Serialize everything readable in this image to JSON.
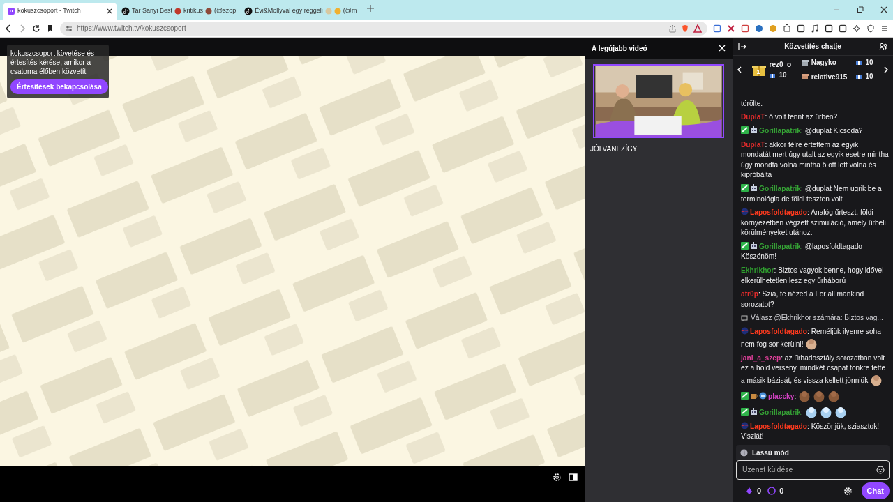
{
  "browser": {
    "tabs": [
      {
        "selected": true,
        "favicon": {
          "kind": "twitch"
        },
        "parts": [
          {
            "kind": "text",
            "text": "kokuszcsoport - Twitch"
          }
        ]
      },
      {
        "selected": false,
        "favicon": {
          "kind": "tiktok"
        },
        "parts": [
          {
            "kind": "text",
            "text": "Tar Sanyi Best"
          },
          {
            "kind": "emoji",
            "color": "#c0392b"
          },
          {
            "kind": "text",
            "text": "kritikus"
          },
          {
            "kind": "emoji",
            "color": "#8e4a3a"
          },
          {
            "kind": "text",
            "text": "(@szop"
          }
        ]
      },
      {
        "selected": false,
        "favicon": {
          "kind": "tiktok"
        },
        "parts": [
          {
            "kind": "text",
            "text": "Évi&Mollyval egy reggeli"
          },
          {
            "kind": "emoji",
            "color": "#d8c8a0"
          },
          {
            "kind": "emoji",
            "color": "#f0b030"
          },
          {
            "kind": "text",
            "text": "(@m"
          }
        ]
      }
    ],
    "url": "https://www.twitch.tv/kokuszcsoport"
  },
  "notice": {
    "text": "kokuszcsoport követése és értesítés kérése, amikor a csatorna élőben közvetít",
    "button": "Értesítések bekapcsolása"
  },
  "latest_video": {
    "heading": "A legújabb videó",
    "channel": "JÓLVANEZÍGY"
  },
  "chat": {
    "title": "Közvetítés chatje",
    "leaderboard": [
      {
        "rank": "1",
        "user": "rez0_o",
        "count": "10"
      },
      {
        "user": "Nagyko",
        "count": "10"
      },
      {
        "user": "relative915",
        "count": "10"
      }
    ],
    "messages": [
      {
        "kind": "system",
        "text": "törölte."
      },
      {
        "kind": "message",
        "user": "DuplaT",
        "color": "#e02b2b",
        "text": ": ő volt fennt az űrben?"
      },
      {
        "kind": "message",
        "badges": [
          {
            "kind": "check"
          },
          {
            "kind": "robot"
          }
        ],
        "user": "Gorillapatrik",
        "color": "#35a135",
        "text": ": @duplat Kicsoda?"
      },
      {
        "kind": "message",
        "user": "DuplaT",
        "color": "#e02b2b",
        "text": ": akkor félre értettem az egyik mondatát mert úgy utalt az egyik esetre mintha úgy mondta volna mintha ő ott lett volna és kipróbálta"
      },
      {
        "kind": "message",
        "badges": [
          {
            "kind": "check"
          },
          {
            "kind": "robot"
          }
        ],
        "user": "Gorillapatrik",
        "color": "#35a135",
        "text": ": @duplat Nem ugrik be a terminológia de földi teszten volt"
      },
      {
        "kind": "message",
        "badges": [
          {
            "kind": "planet"
          }
        ],
        "user": "Laposfoldtagado",
        "color": "#ff3a1e",
        "text": ": Analóg űrteszt, földi környezetben végzett szimuláció, amely űrbeli körülményeket utánoz."
      },
      {
        "kind": "message",
        "badges": [
          {
            "kind": "check"
          },
          {
            "kind": "robot"
          }
        ],
        "user": "Gorillapatrik",
        "color": "#35a135",
        "text": ": @laposfoldtagado Köszönöm!"
      },
      {
        "kind": "message",
        "user": "Ekhrikhor",
        "color": "#2f9e2f",
        "text": ": Biztos vagyok benne, hogy idővel elkerülhetetlen lesz egy űrháború"
      },
      {
        "kind": "message",
        "user": "atr0p",
        "color": "#e02b2b",
        "text": ": Szia, te nézed a For all mankind sorozatot?"
      },
      {
        "kind": "reply",
        "text": "Válasz @Ekhrikhor számára: Biztos vag..."
      },
      {
        "kind": "message",
        "badges": [
          {
            "kind": "planet"
          }
        ],
        "user": "Laposfoldtagado",
        "color": "#ff3a1e",
        "text": ": Reméljük ilyenre soha nem fog sor kerülni!",
        "emotes": [
          {
            "kind": "skin"
          }
        ]
      },
      {
        "kind": "message",
        "user": "jani_a_szep",
        "color": "#e0409a",
        "text": ": az űrhadosztály sorozatban volt ez a hold verseny, mindkét csapat tönkre tette a másik bázisát, és vissza kellett jönniük",
        "emotes": [
          {
            "kind": "skin"
          }
        ]
      },
      {
        "kind": "message",
        "badges": [
          {
            "kind": "check"
          },
          {
            "kind": "mug"
          },
          {
            "kind": "bot"
          }
        ],
        "user": "placcky",
        "color": "#d040c0",
        "text": ":",
        "emotes": [
          {
            "kind": "brown"
          },
          {
            "kind": "brown"
          },
          {
            "kind": "brown"
          }
        ]
      },
      {
        "kind": "message",
        "badges": [
          {
            "kind": "check"
          },
          {
            "kind": "robot"
          }
        ],
        "user": "Gorillapatrik",
        "color": "#35a135",
        "text": ":",
        "emotes": [
          {
            "kind": "blue"
          },
          {
            "kind": "blue"
          },
          {
            "kind": "blue"
          }
        ]
      },
      {
        "kind": "message",
        "badges": [
          {
            "kind": "planet"
          }
        ],
        "user": "Laposfoldtagado",
        "color": "#ff3a1e",
        "text": ": Köszönjük, sziasztok! Viszlát!"
      }
    ],
    "slow_mode": "Lassú mód",
    "input": {
      "placeholder": "Üzenet küldése"
    },
    "bits": "0",
    "points": "0",
    "send": "Chat"
  }
}
